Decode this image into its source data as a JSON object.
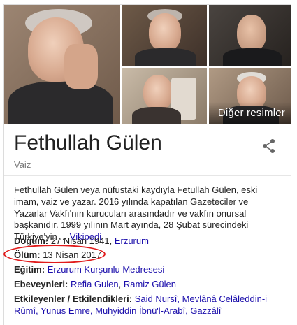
{
  "gallery": {
    "more_images_label": "Diğer resimler"
  },
  "title": "Fethullah Gülen",
  "subtitle": "Vaiz",
  "description": {
    "text": "Fethullah Gülen veya nüfustaki kaydıyla Fetullah Gülen, eski imam, vaiz ve yazar. 2016 yılında kapatılan Gazeteciler ve Yazarlar Vakfı'nın kurucuları arasındadır ve vakfın onursal başkanıdır. 1999 yılının Mart ayında, 28 Şubat sürecindeki Türkiye'yin ...",
    "source_link": "Vikipedi"
  },
  "facts": {
    "birth": {
      "label": "Doğum:",
      "value": "27 Nisan 1941,",
      "link": "Erzurum"
    },
    "death": {
      "label": "Ölüm:",
      "value": "13 Nisan 2017"
    },
    "education": {
      "label": "Eğitim:",
      "link": "Erzurum Kurşunlu Medresesi"
    },
    "parents": {
      "label": "Ebeveynleri:",
      "link1": "Refia Gulen",
      "link2": "Ramiz Gülen"
    },
    "influences": {
      "label": "Etkileyenler / Etkilendikleri:",
      "links": [
        "Said Nursî,",
        "Mevlânâ Celâleddin-i Rûmî,",
        "Yunus Emre,",
        "Muhyiddin İbnü'l-Arabî,",
        "Gazzâlî"
      ]
    }
  },
  "colors": {
    "link": "#1a0dab",
    "annotation_circle": "#e11b1b"
  }
}
